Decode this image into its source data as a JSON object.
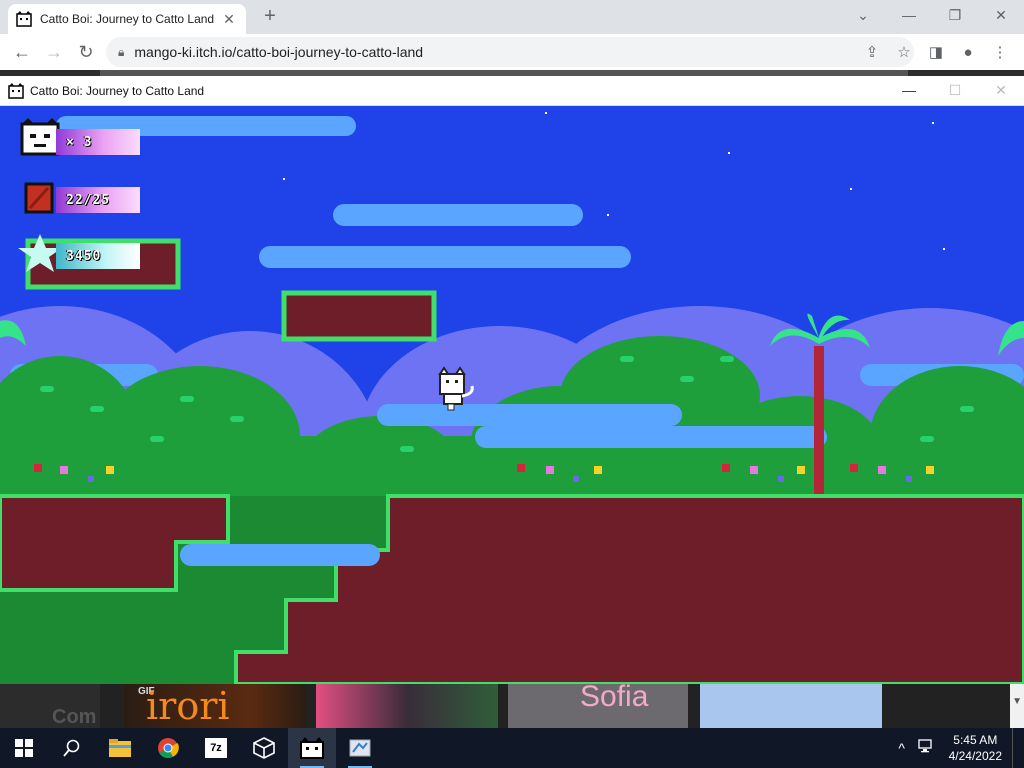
{
  "browser": {
    "tab_title": "Catto Boi: Journey to Catto Land",
    "tab_close": "✕",
    "new_tab": "+",
    "url": "mango-ki.itch.io/catto-boi-journey-to-catto-land",
    "window_controls": {
      "minimize": "⌄",
      "restore": "—",
      "maximize": "❐",
      "close": "✕"
    }
  },
  "game_window": {
    "title": "Catto Boi: Journey to Catto Land",
    "controls": {
      "minimize": "—",
      "maximize": "☐",
      "close": "✕"
    }
  },
  "hud": {
    "lives": "× 3",
    "crates": "22/25",
    "score": "3450"
  },
  "page_below": {
    "partial_text": "Com",
    "gif_badge": "GIF",
    "thumb1_text": "irori",
    "thumb3_text": "Sofia"
  },
  "taskbar": {
    "items": [
      "start-icon",
      "search-icon",
      "file-explorer-icon",
      "chrome-icon",
      "7zip-icon",
      "3d-viewer-icon",
      "catto-boi-icon",
      "paint-icon"
    ],
    "seven_zip_label": "7z",
    "time": "5:45 AM",
    "date": "4/24/2022",
    "tray_chevron": "^"
  },
  "colors": {
    "sky": "#1f43e8",
    "cloud": "#5aa5ff",
    "grass": "#1f9e3c",
    "dirt": "#6e1e28",
    "hud_purple": "#8f3ad6"
  }
}
